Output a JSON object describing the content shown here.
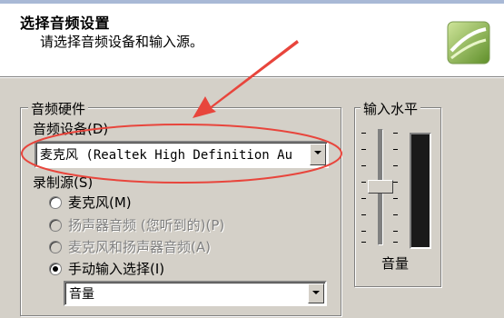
{
  "header": {
    "title": "选择音频设置",
    "subtitle": "请选择音频设备和输入源。"
  },
  "audio_hardware": {
    "group_label": "音频硬件",
    "device_label": "音频设备(D)",
    "device_value": "麦克风 (Realtek High Definition Au",
    "source_label": "录制源(S)",
    "sources": [
      {
        "label": "麦克风(M)",
        "selected": false,
        "enabled": true
      },
      {
        "label": "扬声器音频 (您听到的)(P)",
        "selected": false,
        "enabled": false
      },
      {
        "label": "麦克风和扬声器音频(A)",
        "selected": false,
        "enabled": false
      },
      {
        "label": "手动输入选择(I)",
        "selected": true,
        "enabled": true
      }
    ],
    "manual_select_value": "音量"
  },
  "input_level": {
    "group_label": "输入水平",
    "slider_label": "音量"
  },
  "colors": {
    "arrow": "#e8453c",
    "header_bg": "#ffffff",
    "dialog_bg": "#d4d0c8"
  }
}
